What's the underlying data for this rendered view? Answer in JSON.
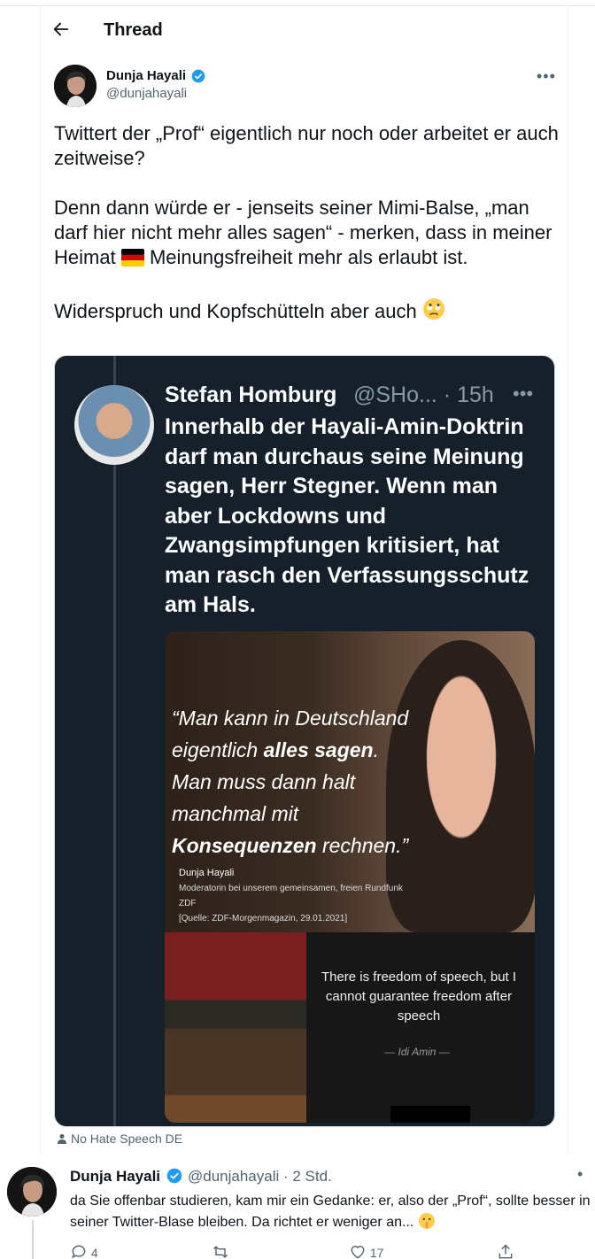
{
  "header": {
    "title": "Thread"
  },
  "tweet": {
    "author_name": "Dunja Hayali",
    "author_handle": "@dunjahayali",
    "paragraphs": [
      "Twittert der „Prof“ eigentlich nur noch oder arbeitet er auch zeitweise?",
      "Denn dann würde er - jenseits seiner Mimi-Balse, „man darf hier nicht mehr alles sagen“ - merken, dass in meiner Heimat",
      "Meinungsfreiheit mehr als erlaubt ist.",
      "Widerspruch und Kopfschütteln aber auch"
    ]
  },
  "media": {
    "name": "Stefan Homburg",
    "handle_time": "@SHo... · 15h",
    "text": "Innerhalb der Hayali-Amin-Doktrin darf man durchaus seine Meinung sagen, Herr Stegner. Wenn man aber Lockdowns und Zwangsimpfungen kritisiert, hat man rasch den Verfassungsschutz am Hals.",
    "quote_line1": "Man kann in Deutschland",
    "quote_line2a": "eigentlich ",
    "quote_line2b": "alles sagen",
    "quote_line2c": ".",
    "quote_line3": "Man muss dann halt",
    "quote_line4": "manchmal mit",
    "quote_line5a": "Konsequenzen",
    "quote_line5b": " rechnen.",
    "attrib_name": "Dunja Hayali",
    "attrib_role": "Moderatorin bei unserem gemeinsamen, freien Rundfunk ZDF",
    "attrib_source": "[Quelle: ZDF-Morgenmagazin, 29.01.2021]",
    "amin_quote": "There is freedom of speech, but I cannot guarantee freedom after speech",
    "amin_sig": "— Idi Amin —"
  },
  "sensitive_label": "No Hate Speech DE",
  "reply": {
    "author_name": "Dunja Hayali",
    "meta": "@dunjahayali · 2 Std.",
    "text": "da Sie offenbar studieren, kam mir ein Gedanke: er, also der „Prof“, sollte besser in seiner Twitter-Blase bleiben. Da richtet er weniger an...",
    "reply_count": "4",
    "like_count": "17"
  },
  "colors": {
    "accent": "#1d9bf0",
    "muted": "#536471",
    "media_bg": "#15202b"
  }
}
